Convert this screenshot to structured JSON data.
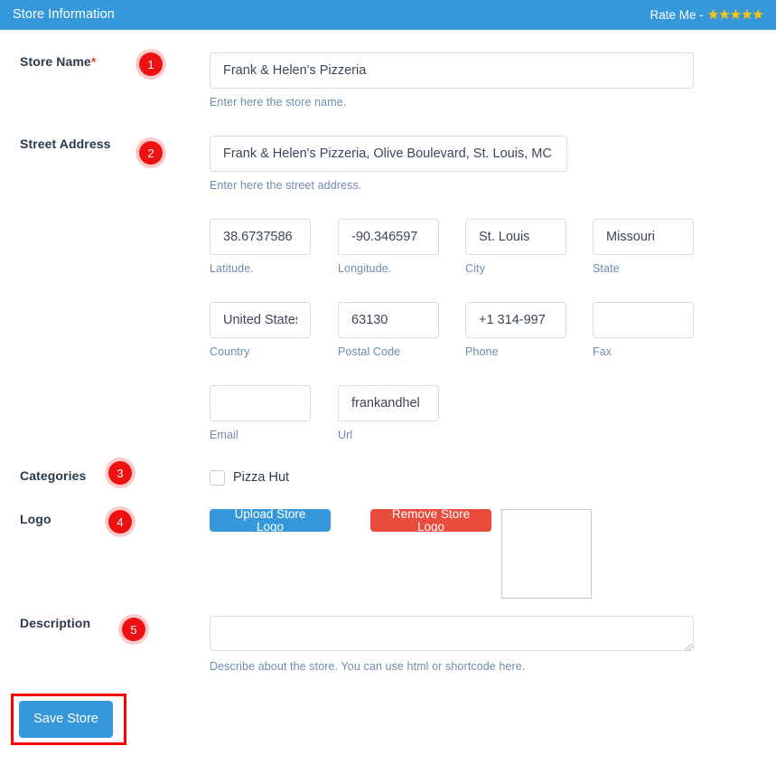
{
  "header": {
    "title": "Store Information",
    "rate_label": "Rate Me -",
    "star_glyph": "★",
    "star_count": 5,
    "bar_color": "#3498db",
    "star_color": "#f5c518"
  },
  "badges": {
    "one": "1",
    "two": "2",
    "three": "3",
    "four": "4",
    "five": "5",
    "color": "#ee1111"
  },
  "fields": {
    "store_name": {
      "label": "Store Name",
      "required_mark": "*",
      "value": "Frank & Helen's Pizzeria",
      "hint": "Enter here the store name."
    },
    "street_address": {
      "label": "Street Address",
      "value": "Frank & Helen's Pizzeria, Olive Boulevard, St. Louis, MC",
      "hint": "Enter here the street address."
    },
    "latitude": {
      "value": "38.6737586",
      "hint": "Latitude."
    },
    "longitude": {
      "value": "-90.346597",
      "hint": "Longitude."
    },
    "city": {
      "value": "St. Louis",
      "hint": "City"
    },
    "state": {
      "value": "Missouri",
      "hint": "State"
    },
    "country": {
      "value": "United States",
      "hint": "Country"
    },
    "postal_code": {
      "value": "63130",
      "hint": "Postal Code"
    },
    "phone": {
      "value": "+1 314-997",
      "hint": "Phone"
    },
    "fax": {
      "value": "",
      "hint": "Fax"
    },
    "email": {
      "value": "",
      "hint": "Email"
    },
    "url": {
      "value": "frankandhel",
      "hint": "Url"
    }
  },
  "categories": {
    "label": "Categories",
    "items": [
      {
        "label": "Pizza Hut",
        "checked": false
      }
    ]
  },
  "logo": {
    "label": "Logo",
    "upload_label": "Upload Store Logo",
    "remove_label": "Remove Store Logo",
    "upload_color": "#3498db",
    "remove_color": "#e74c3c"
  },
  "description": {
    "label": "Description",
    "value": "",
    "hint": "Describe about the store. You can use html or shortcode here."
  },
  "save": {
    "label": "Save Store",
    "button_color": "#3498db",
    "highlight_color": "#ff0000"
  }
}
